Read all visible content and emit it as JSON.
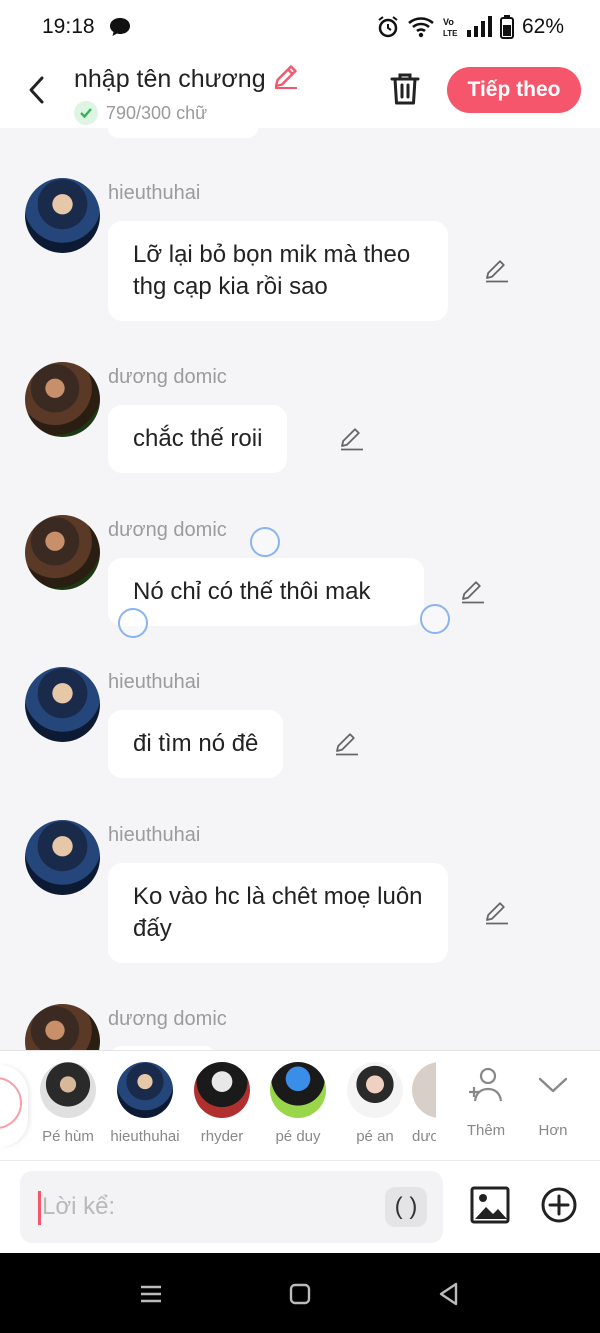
{
  "status_bar": {
    "time": "19:18",
    "battery": "62%",
    "icons": [
      "chat-bubble-icon",
      "alarm-icon",
      "wifi-icon",
      "volte-icon",
      "signal-icon",
      "battery-icon"
    ]
  },
  "header": {
    "title": "nhập tên chương",
    "word_count": "790/300 chữ",
    "next_label": "Tiếp theo",
    "accent_color": "#f5566b"
  },
  "messages": [
    {
      "sender": "hieuthuhai",
      "text": "Lỡ lại bỏ bọn mik mà theo thg cạp kia rồi sao"
    },
    {
      "sender": "dương domic",
      "text": "chắc thế roii"
    },
    {
      "sender": "dương domic",
      "text": "Nó chỉ có thế thôi mak"
    },
    {
      "sender": "hieuthuhai",
      "text": "đi tìm nó đê"
    },
    {
      "sender": "hieuthuhai",
      "text": "Ko vào hc là chêt moẹ luôn đấy"
    },
    {
      "sender": "dương domic",
      "text": ""
    }
  ],
  "characters": [
    {
      "name": "Pé hùm"
    },
    {
      "name": "hieuthuhai"
    },
    {
      "name": "rhyder"
    },
    {
      "name": "pé duy"
    },
    {
      "name": "pé an"
    },
    {
      "name": "dươ"
    }
  ],
  "side_actions": {
    "add_label": "Thêm",
    "more_label": "Hơn"
  },
  "composer": {
    "placeholder": "Lời kể:",
    "bracket_label": "( )"
  }
}
